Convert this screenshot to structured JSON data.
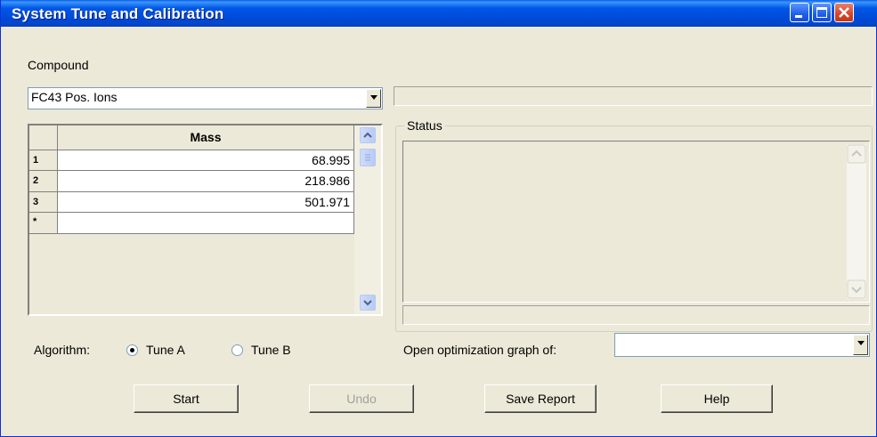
{
  "window": {
    "title": "System Tune and Calibration",
    "colors": {
      "titlebar": "#0054e3",
      "face": "#ece9d8",
      "close": "#d6452a"
    }
  },
  "titlebar_buttons": [
    {
      "name": "minimize-icon"
    },
    {
      "name": "maximize-icon"
    },
    {
      "name": "close-icon"
    }
  ],
  "compound": {
    "label": "Compound",
    "selected": "FC43 Pos. Ions"
  },
  "mass_table": {
    "header": "Mass",
    "rows": [
      {
        "index": "1",
        "mass": "68.995"
      },
      {
        "index": "2",
        "mass": "218.986"
      },
      {
        "index": "3",
        "mass": "501.971"
      },
      {
        "index": "*",
        "mass": ""
      }
    ]
  },
  "status": {
    "label": "Status",
    "text": ""
  },
  "algorithm": {
    "label": "Algorithm:",
    "options": [
      {
        "label": "Tune A",
        "selected": true
      },
      {
        "label": "Tune B",
        "selected": false
      }
    ]
  },
  "optimization": {
    "label": "Open optimization graph of:",
    "selected": ""
  },
  "buttons": {
    "start": "Start",
    "undo": "Undo",
    "save_report": "Save Report",
    "help": "Help"
  }
}
